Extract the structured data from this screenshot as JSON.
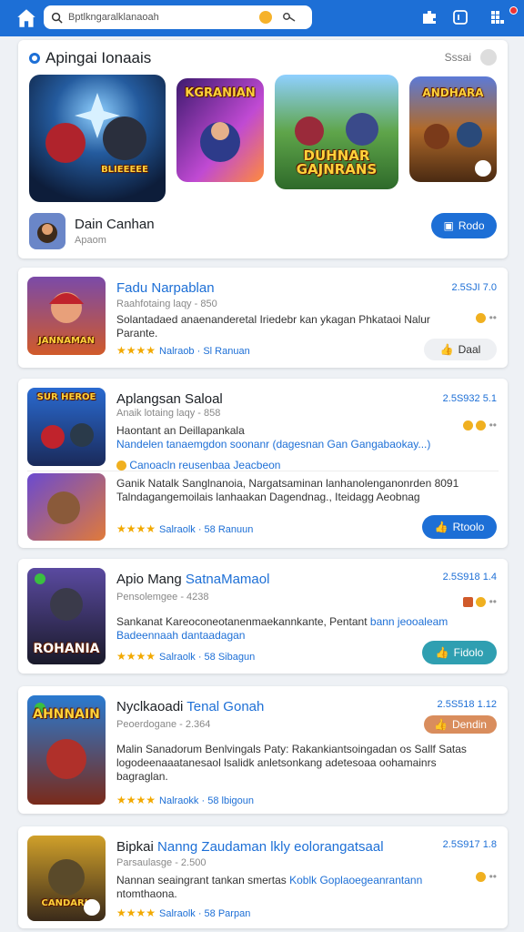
{
  "search": {
    "query": "Bptlkngaralklanaoah"
  },
  "featured": {
    "title": "Apingai Ionaais",
    "count": "Sssai",
    "games": [
      {
        "overlay": "BLIEEEEE"
      },
      {
        "overlay": "KGRANIAN"
      },
      {
        "overlay": "DUHNAR GAJNRANS"
      },
      {
        "overlay": "ANDHARA"
      }
    ],
    "developer": {
      "name": "Dain Canhan",
      "sub": "Apaom"
    },
    "button": "Rodo"
  },
  "items": [
    {
      "title_black": "",
      "title_blue": "Fadu Narpablan",
      "version": "2.5SJI 7.0",
      "meta": "Raahfotaing laqy - 850",
      "desc_black": "Solantadaed anaenanderetal Iriedebr kan ykagan Phkataoi Nalur Parante.",
      "desc_blue": "",
      "rating": "Nalraob · Sl Ranuan",
      "thumb_text": "JANNAMAN",
      "button": "Daal"
    },
    {
      "title_black": "Aplangsan Saloal",
      "title_blue": "",
      "version": "2.5S932 5.1",
      "meta": "Anaik lotaing laqy - 858",
      "desc_black": "Haontant an Deillapankala",
      "desc_blue": "Nandelen tanaemgdon soonanr (dagesnan Gan Gangabaokay...)",
      "extra": "Canoacln reusenbaa Jeacbeon",
      "sub_title": "Ganik Natalk Sanglnanoia, Nargatsaminan lanhanolenganonrden 8091 Talndagangemoilais lanhaakan Dagendnag., Iteidagg Aeobnag",
      "rating": "Salraolk · 58 Ranuun",
      "thumb_text": "SUR HEROE",
      "button": "Rtoolo"
    },
    {
      "title_black": "Apio Mang",
      "title_blue": "SatnaMamaol",
      "version": "2.5S918 1.4",
      "meta": "Pensolemgee - 4238",
      "desc_black": "Sankanat Kareoconeotanenmaekannkante, Pentant",
      "desc_blue": "bann jeooaleam Badeennaah dantaadagan",
      "rating": "Salraolk · 58 Sibagun",
      "thumb_text": "ROHANIA",
      "button": "Fidolo"
    },
    {
      "title_black": "Nyclkaoadi",
      "title_blue": "Tenal Gonah",
      "version": "2.5S518 1.12",
      "meta": "Peoerdogane - 2.364",
      "desc_black": "Malin Sanadorum Benlvingals Paty: Rakankiantsoingadan os Sallf Satas logodeenaaatanesaol lsalidk anletsonkang adetesoaa oohamainrs bagraglan.",
      "desc_blue": "",
      "rating": "Nalraokk · 58 lbigoun",
      "thumb_text": "AHNNAIN",
      "button": "Dendin"
    },
    {
      "title_black": "Bipkai",
      "title_blue": "Nanng Zaudaman lkly eolorangatsaal",
      "version": "2.5S917 1.8",
      "meta": "Parsaulasge - 2.500",
      "desc_black": "Nannan seaingrant tankan smertas",
      "desc_blue": "Koblk Goplaoegeanrantann",
      "desc_tail": "ntomthaona.",
      "rating": "Salraolk · 58 Parpan",
      "thumb_text": "CANDARK"
    }
  ],
  "colors": {
    "accent": "#1d6fd6",
    "teal": "#2f9fb1",
    "orange": "#d98d5d",
    "star": "#f2a900"
  }
}
